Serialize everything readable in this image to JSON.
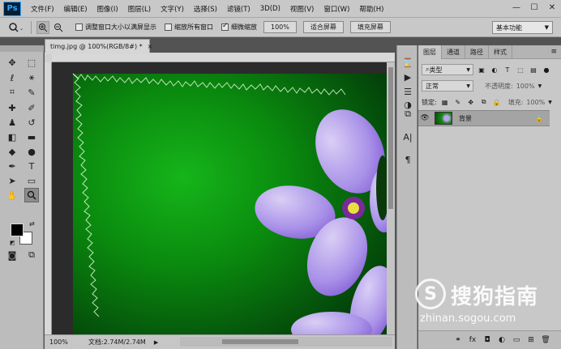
{
  "app": {
    "logo": "Ps"
  },
  "menu": [
    "文件(F)",
    "编辑(E)",
    "图像(I)",
    "图层(L)",
    "文字(Y)",
    "选择(S)",
    "滤镜(T)",
    "3D(D)",
    "视图(V)",
    "窗口(W)",
    "帮助(H)"
  ],
  "window_controls": {
    "minimize": "—",
    "maximize": "☐",
    "close": "✕"
  },
  "options": {
    "tool_icon": "zoom-icon",
    "resize_windows": "调整窗口大小以满屏显示",
    "zoom_all_windows": "缩放所有窗口",
    "scrubby_zoom": "细微缩放",
    "zoom_value": "100%",
    "fit_screen": "适合屏幕",
    "fill_screen": "填充屏幕",
    "resize_windows_checked": false,
    "zoom_all_checked": false,
    "scrubby_checked": true,
    "workspace": "基本功能"
  },
  "document": {
    "tab_title": "timg.jpg @ 100%(RGB/8#) *",
    "close": "×",
    "status_zoom": "100%",
    "status_doc": "文档:2.74M/2.74M",
    "status_arrow": "▶"
  },
  "tools": [
    {
      "name": "move-tool-icon",
      "glyph": "✥"
    },
    {
      "name": "marquee-tool-icon",
      "glyph": "⬚"
    },
    {
      "name": "lasso-tool-icon",
      "glyph": "ℓ"
    },
    {
      "name": "magic-wand-tool-icon",
      "glyph": "⚹"
    },
    {
      "name": "crop-tool-icon",
      "glyph": "⌗"
    },
    {
      "name": "eyedropper-tool-icon",
      "glyph": "✎"
    },
    {
      "name": "healing-brush-tool-icon",
      "glyph": "✚"
    },
    {
      "name": "brush-tool-icon",
      "glyph": "✐"
    },
    {
      "name": "clone-stamp-tool-icon",
      "glyph": "♟"
    },
    {
      "name": "history-brush-tool-icon",
      "glyph": "↺"
    },
    {
      "name": "eraser-tool-icon",
      "glyph": "◧"
    },
    {
      "name": "gradient-tool-icon",
      "glyph": "▬"
    },
    {
      "name": "blur-tool-icon",
      "glyph": "◆"
    },
    {
      "name": "dodge-tool-icon",
      "glyph": "●"
    },
    {
      "name": "pen-tool-icon",
      "glyph": "✒"
    },
    {
      "name": "type-tool-icon",
      "glyph": "T"
    },
    {
      "name": "path-selection-tool-icon",
      "glyph": "➤"
    },
    {
      "name": "shape-tool-icon",
      "glyph": "▭"
    },
    {
      "name": "hand-tool-icon",
      "glyph": "✋"
    },
    {
      "name": "zoom-tool-icon",
      "glyph": "🔍"
    }
  ],
  "colors": {
    "foreground": "#000000",
    "background": "#ffffff",
    "swap_glyph": "⇄",
    "default_glyph": "◩"
  },
  "bottom_tools": [
    {
      "name": "quick-mask-icon",
      "glyph": "◙"
    },
    {
      "name": "screen-mode-icon",
      "glyph": "⧉"
    }
  ],
  "mid_icons": [
    {
      "name": "history-panel-icon",
      "glyph": "⌛"
    },
    {
      "name": "play-action-icon",
      "glyph": "▶"
    },
    {
      "name": "properties-panel-icon",
      "glyph": "☰"
    },
    {
      "name": "adjustments-panel-icon",
      "glyph": "◑"
    },
    {
      "name": "clone-source-panel-icon",
      "glyph": "⧉"
    },
    {
      "name": "character-panel-icon",
      "glyph": "A|"
    },
    {
      "name": "paragraph-panel-icon",
      "glyph": "¶"
    }
  ],
  "layers_panel": {
    "tabs": [
      "图层",
      "通道",
      "路径",
      "样式"
    ],
    "menu_glyph": "≡",
    "filter_kind": "类型",
    "blend_mode": "正常",
    "opacity_label": "不透明度:",
    "opacity_value": "100%",
    "lock_label": "锁定:",
    "fill_label": "填充:",
    "fill_value": "100%",
    "layers": [
      {
        "name": "背景",
        "visible": true,
        "locked": true
      }
    ],
    "footer_icons": [
      "link-icon",
      "fx-icon",
      "mask-icon",
      "adjustment-icon",
      "group-icon",
      "new-layer-icon",
      "trash-icon"
    ],
    "footer_glyphs": [
      "⚭",
      "fx",
      "◘",
      "◐",
      "▭",
      "⊞",
      "🗑"
    ]
  },
  "watermark": {
    "logo_letter": "S",
    "title": "搜狗指南",
    "url": "zhinan.sogou.com"
  }
}
